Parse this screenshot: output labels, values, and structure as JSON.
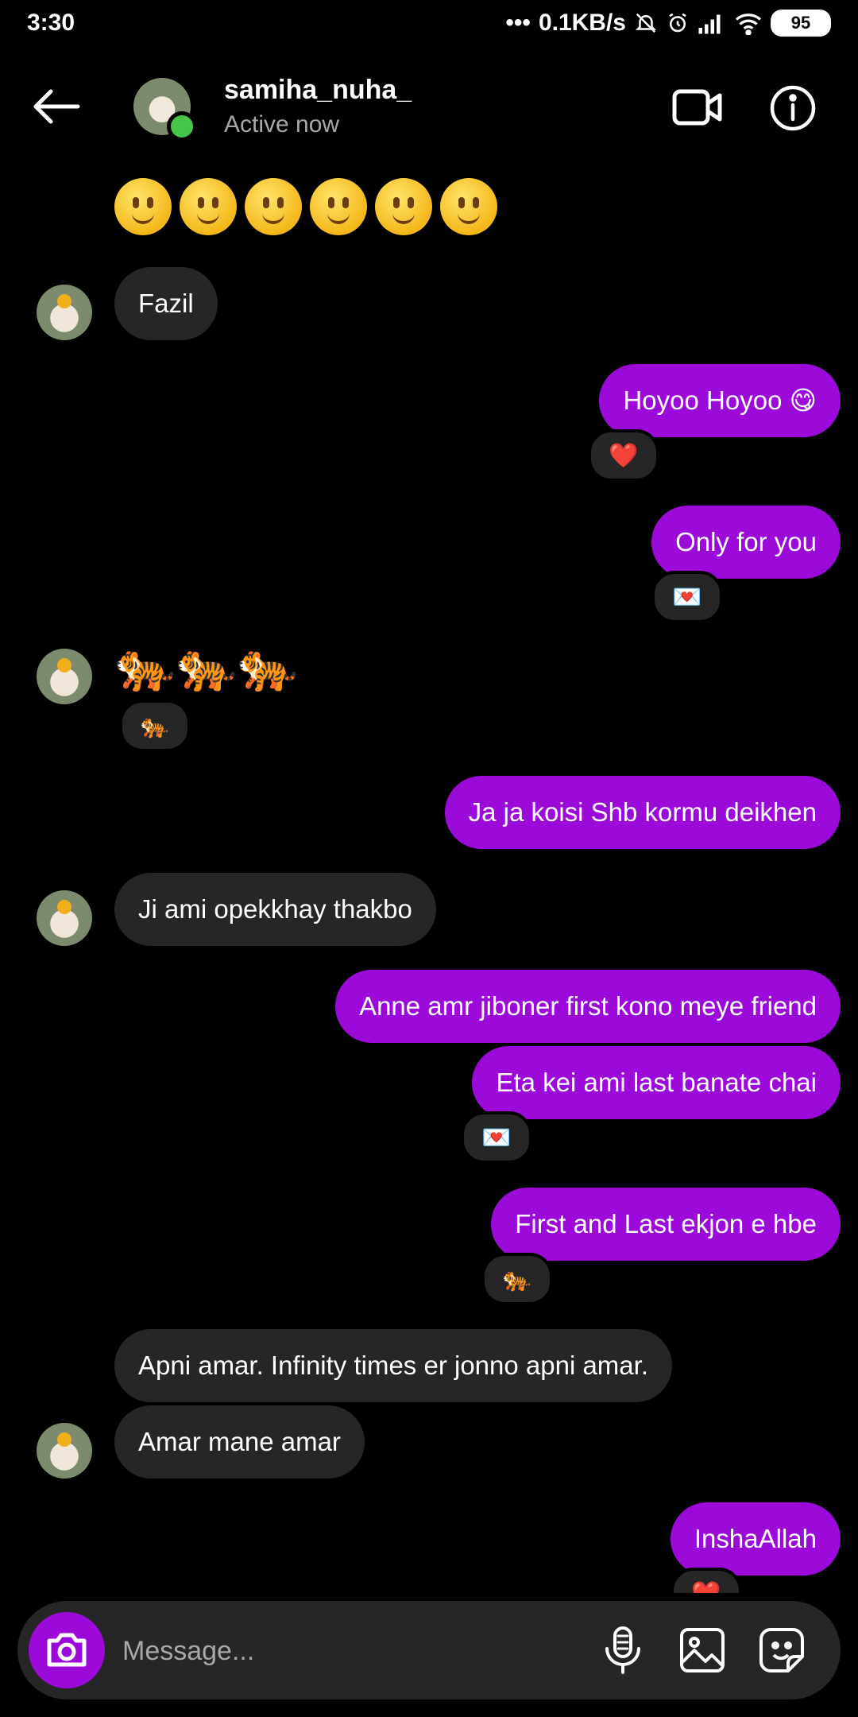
{
  "status_bar": {
    "time": "3:30",
    "network_speed": "0.1KB/s",
    "battery": "95",
    "more_glyph": "•••",
    "icons": [
      "mute-bell-icon",
      "alarm-icon",
      "signal-icon",
      "wifi-icon",
      "battery-icon"
    ]
  },
  "header": {
    "username": "samiha_nuha_",
    "status": "Active now",
    "online_color": "#45c64a"
  },
  "thread": {
    "emoji_row": [
      "🙂",
      "🙂",
      "🙂",
      "🙂",
      "🙂",
      "🙂"
    ],
    "messages": [
      {
        "from": "them",
        "text": "Fazil"
      },
      {
        "from": "me",
        "text": "Hoyoo Hoyoo 😋",
        "reaction": "❤️"
      },
      {
        "from": "me",
        "text": "Only for you",
        "reaction": "💌"
      },
      {
        "from": "them",
        "text": "🐅🐅🐅",
        "reaction": "🐅"
      },
      {
        "from": "me",
        "text": "Ja ja koisi Shb kormu deikhen"
      },
      {
        "from": "them",
        "text": "Ji ami opekkhay thakbo"
      },
      {
        "from": "me",
        "text": "Anne amr jiboner first kono meye friend"
      },
      {
        "from": "me",
        "text": "Eta kei ami last banate chai",
        "reaction": "💌"
      },
      {
        "from": "me",
        "text": "First and Last ekjon e hbe",
        "reaction": "🐅"
      },
      {
        "from": "them",
        "text": "Apni amar. Infinity times er jonno apni amar."
      },
      {
        "from": "them",
        "text": "Amar mane amar"
      },
      {
        "from": "me",
        "text": "InshaAllah",
        "reaction": "❤️"
      }
    ]
  },
  "composer": {
    "placeholder": "Message..."
  },
  "colors": {
    "outgoing_bubble": "#9b0ad8",
    "incoming_bubble": "#262626",
    "background": "#000000"
  }
}
